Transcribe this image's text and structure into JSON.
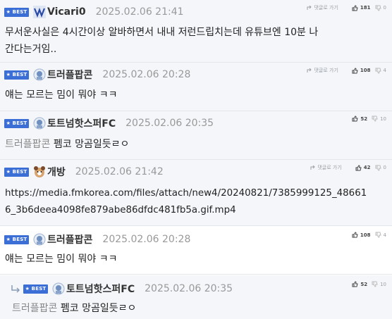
{
  "badge_label": "★ BEST",
  "reply_label": "댓글로 가기",
  "comments": [
    {
      "nick": "Vicari0",
      "date": "2025.02.06 21:41",
      "line1": "무서운사실은 4시간이상 알바하면서 내내 저런드립치는데 유튜브엔 10분 나",
      "line2": "간다는거임..",
      "up": "181",
      "down": "0"
    },
    {
      "nick": "트러플팝콘",
      "date": "2025.02.06 20:28",
      "text": "얘는 모르는 밈이 뭐야 ㅋㅋ",
      "up": "108",
      "down": "4"
    },
    {
      "nick": "토트넘핫스퍼FC",
      "date": "2025.02.06 20:35",
      "mention": "트러플팝콘",
      "text": "펨코 망곰일듯ㄹㅇ",
      "up": "52",
      "down": "10"
    },
    {
      "nick": "개방",
      "date": "2025.02.06 21:42",
      "line1": "https://media.fmkorea.com/files/attach/new4/20240821/7385999125_48661",
      "line2": "6_3b6deea4098fe879abe86dfdc481fb5a.gif.mp4",
      "up": "42",
      "down": "0"
    },
    {
      "nick": "트러플팝콘",
      "date": "2025.02.06 20:28",
      "text": "얘는 모르는 밈이 뭐야 ㅋㅋ",
      "up": "108",
      "down": "4"
    },
    {
      "nick": "토트넘핫스퍼FC",
      "date": "2025.02.06 20:35",
      "mention": "트러플팝콘",
      "text": "펨코 망곰일듯ㄹㅇ",
      "up": "52",
      "down": "10"
    }
  ]
}
